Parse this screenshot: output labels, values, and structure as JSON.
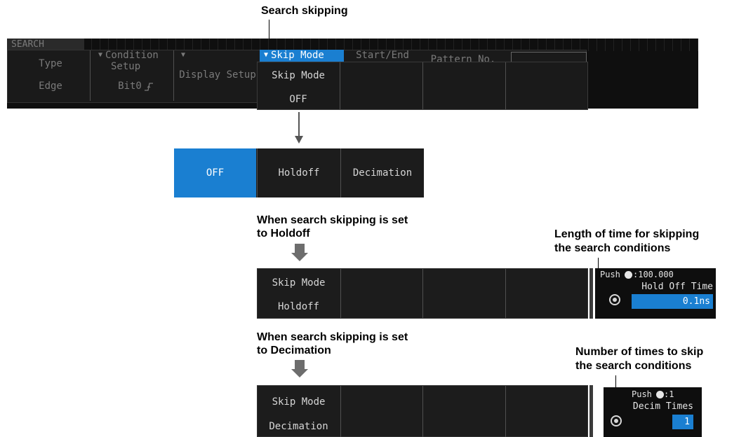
{
  "captions": {
    "search_skipping": "Search skipping",
    "holdoff_title_l1": "When search skipping is set",
    "holdoff_title_l2": "to Holdoff",
    "decimation_title_l1": "When search skipping is set",
    "decimation_title_l2": "to Decimation",
    "length_l1": "Length of time for skipping",
    "length_l2": "the search conditions",
    "number_l1": "Number of times to skip",
    "number_l2": "the search conditions"
  },
  "top_menu": {
    "search": "SEARCH",
    "type_label": "Type",
    "type_value": "Edge",
    "cond_line1": "Condition",
    "cond_line2": "Setup",
    "cond_value": "Bit0",
    "display_setup": "Display Setup",
    "tab_skip_mode": "Skip Mode",
    "tab_start_end": "Start/End",
    "tab_pattern_no": "Pattern No.",
    "skip_label": "Skip Mode",
    "skip_value": "OFF"
  },
  "options": [
    "OFF",
    "Holdoff",
    "Decimation"
  ],
  "holdoff_panel": {
    "skip_label": "Skip Mode",
    "skip_value": "Holdoff",
    "push_text": "Push",
    "push_value": ":100.000",
    "field_label": "Hold Off Time",
    "field_value": "0.1ns"
  },
  "decimation_panel": {
    "skip_label": "Skip Mode",
    "skip_value": "Decimation",
    "push_text": "Push",
    "push_value": ":1",
    "field_label": "Decim Times",
    "field_value": "1"
  },
  "colors": {
    "selected_blue": "#1a7fd1",
    "screen_bg": "#0f0f0f",
    "arrow_gray": "#6d6d6d"
  }
}
